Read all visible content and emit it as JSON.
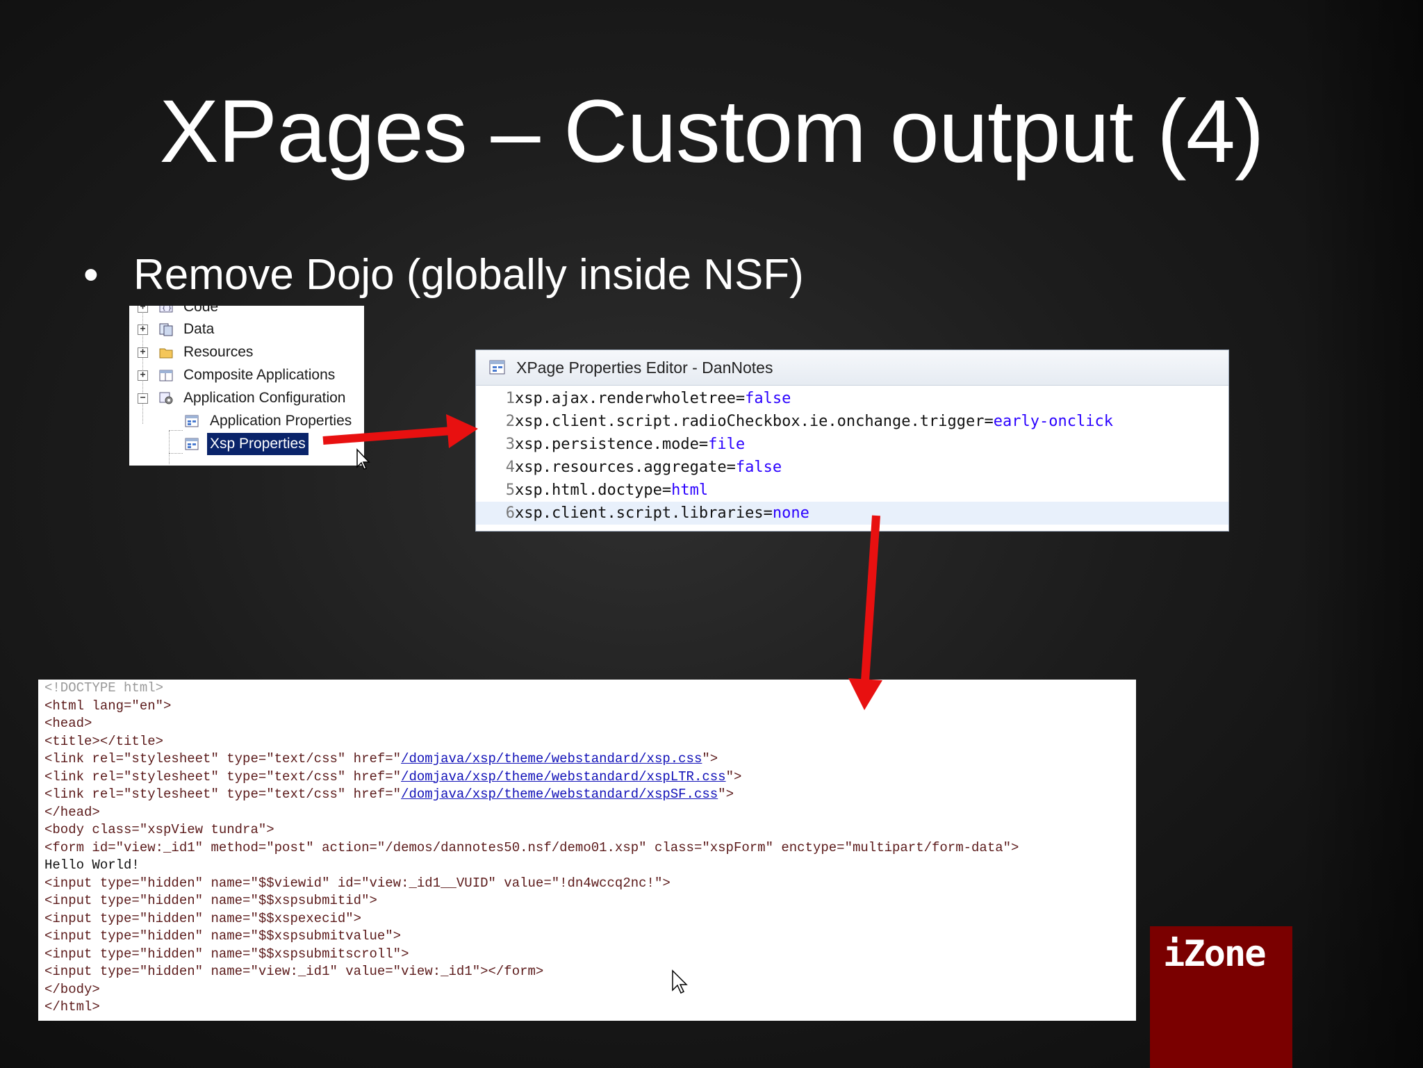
{
  "slide": {
    "title": "XPages – Custom output (4)",
    "bullet_mark": "•",
    "bullet": "Remove Dojo (globally inside NSF)"
  },
  "tree": {
    "items": [
      {
        "label": "Code",
        "expander": "+",
        "icon": "code-icon"
      },
      {
        "label": "Data",
        "expander": "+",
        "icon": "data-icon"
      },
      {
        "label": "Resources",
        "expander": "+",
        "icon": "folder-icon"
      },
      {
        "label": "Composite Applications",
        "expander": "+",
        "icon": "composite-app-icon"
      },
      {
        "label": "Application Configuration",
        "expander": "−",
        "icon": "config-gear-icon"
      },
      {
        "label": "Application Properties",
        "icon": "properties-icon"
      },
      {
        "label": "Xsp Properties",
        "icon": "properties-icon",
        "selected": true
      }
    ]
  },
  "editor": {
    "title": "XPage Properties Editor - DanNotes",
    "lines": [
      {
        "n": "1",
        "key": "xsp.ajax.renderwholetree=",
        "value": "false"
      },
      {
        "n": "2",
        "key": "xsp.client.script.radioCheckbox.ie.onchange.trigger=",
        "value": "early-onclick"
      },
      {
        "n": "3",
        "key": "xsp.persistence.mode=",
        "value": "file"
      },
      {
        "n": "4",
        "key": "xsp.resources.aggregate=",
        "value": "false"
      },
      {
        "n": "5",
        "key": "xsp.html.doctype=",
        "value": "html"
      },
      {
        "n": "6",
        "key": "xsp.client.script.libraries=",
        "value": "none"
      }
    ]
  },
  "output": {
    "doctype": "<!DOCTYPE html>",
    "html_open": "<html lang=\"en\">",
    "head_open": "<head>",
    "title_tag": "<title></title>",
    "links": [
      {
        "pre": "<link rel=\"stylesheet\" type=\"text/css\" href=\"",
        "href": "/domjava/xsp/theme/webstandard/xsp.css",
        "post": "\">"
      },
      {
        "pre": "<link rel=\"stylesheet\" type=\"text/css\" href=\"",
        "href": "/domjava/xsp/theme/webstandard/xspLTR.css",
        "post": "\">"
      },
      {
        "pre": "<link rel=\"stylesheet\" type=\"text/css\" href=\"",
        "href": "/domjava/xsp/theme/webstandard/xspSF.css",
        "post": "\">"
      }
    ],
    "head_close": "</head>",
    "body_open": "<body class=\"xspView tundra\">",
    "form_open": "<form id=\"view:_id1\" method=\"post\" action=\"/demos/dannotes50.nsf/demo01.xsp\" class=\"xspForm\" enctype=\"multipart/form-data\">",
    "hello": "Hello World!",
    "inputs": [
      "<input type=\"hidden\" name=\"$$viewid\" id=\"view:_id1__VUID\" value=\"!dn4wccq2nc!\">",
      "<input type=\"hidden\" name=\"$$xspsubmitid\">",
      "<input type=\"hidden\" name=\"$$xspexecid\">",
      "<input type=\"hidden\" name=\"$$xspsubmitvalue\">",
      "<input type=\"hidden\" name=\"$$xspsubmitscroll\">",
      "<input type=\"hidden\" name=\"view:_id1\" value=\"view:_id1\"></form>"
    ],
    "body_close": "</body>",
    "html_close": "</html>"
  },
  "logo": {
    "text": "iZone"
  },
  "colors": {
    "arrow": "#e81010",
    "selection": "#0a246a",
    "value": "#2a00ff",
    "logo_bg": "#7a0000"
  }
}
